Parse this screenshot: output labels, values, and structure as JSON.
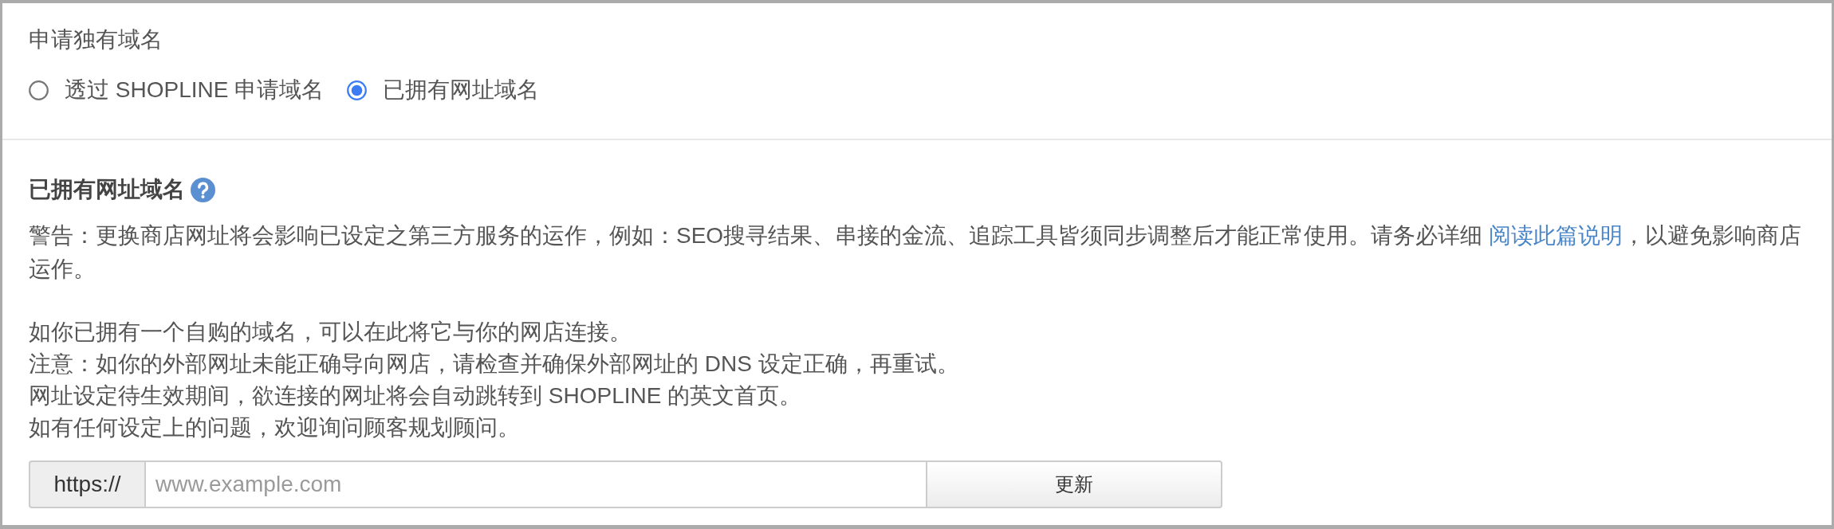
{
  "domain_application": {
    "title": "申请独有域名",
    "options": [
      {
        "label": "透过 SHOPLINE 申请域名",
        "selected": false
      },
      {
        "label": "已拥有网址域名",
        "selected": true
      }
    ]
  },
  "own_domain": {
    "heading": "已拥有网址域名",
    "warning": {
      "before": "警告：更换商店网址将会影响已设定之第三方服务的运作，例如：SEO搜寻结果、串接的金流、追踪工具皆须同步调整后才能正常使用。请务必详细 ",
      "link": "阅读此篇说明",
      "after": "，以避免影响商店运作。"
    },
    "notes": [
      "如你已拥有一个自购的域名，可以在此将它与你的网店连接。",
      "注意：如你的外部网址未能正确导向网店，请检查并确保外部网址的 DNS 设定正确，再重试。",
      "网址设定待生效期间，欲连接的网址将会自动跳转到 SHOPLINE 的英文首页。",
      "如有任何设定上的问题，欢迎询问顾客规划顾问。"
    ],
    "url_prefix": "https://",
    "url_field": {
      "placeholder": "www.example.com"
    },
    "update_button": "更新"
  }
}
